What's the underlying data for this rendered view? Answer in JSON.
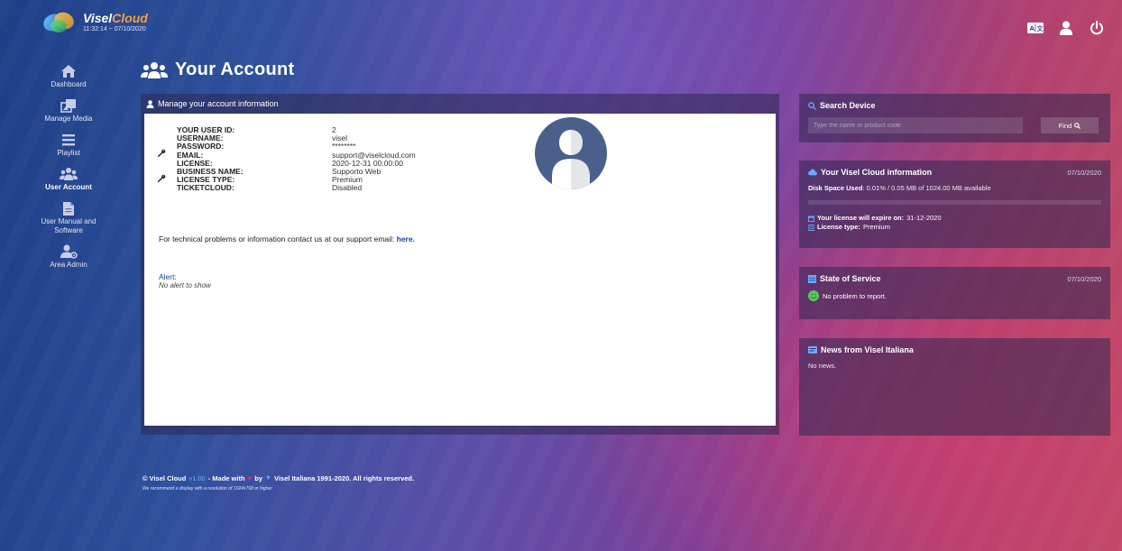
{
  "header": {
    "brand_part1": "Visel",
    "brand_part2": "Cloud",
    "clock": "11:32:14 ~ 07/10/2020",
    "icons": [
      "translate-icon",
      "user-icon",
      "power-icon"
    ]
  },
  "sidebar": {
    "items": [
      {
        "label": "Dashboard",
        "icon": "home-icon"
      },
      {
        "label": "Manage Media",
        "icon": "media-icon"
      },
      {
        "label": "Playlist",
        "icon": "list-icon"
      },
      {
        "label": "User Account",
        "icon": "users-icon",
        "active": true
      },
      {
        "label": "User Manual and Software",
        "icon": "file-icon"
      },
      {
        "label": "Area Admin",
        "icon": "admin-icon"
      }
    ]
  },
  "page": {
    "title": "Your Account"
  },
  "account": {
    "panel_title": "Manage your account information",
    "fields": [
      {
        "key": "YOUR USER ID:",
        "value": "2"
      },
      {
        "key": "USERNAME:",
        "value": "visel"
      },
      {
        "key": "PASSWORD:",
        "value": "********"
      },
      {
        "key": "EMAIL:",
        "value": "support@viselcloud.com"
      },
      {
        "key": "LICENSE:",
        "value": "2020-12-31 00:00:00"
      },
      {
        "key": "BUSINESS NAME:",
        "value": "Supporto Web"
      },
      {
        "key": "LICENSE TYPE:",
        "value": "Premium"
      },
      {
        "key": "TICKETCLOUD:",
        "value": "Disabled"
      }
    ],
    "contact_text": "For technical problems or information contact us at our support email:",
    "contact_link": "here.",
    "alert_label": "Alert:",
    "alert_value": "No alert to show"
  },
  "search": {
    "title": "Search Device",
    "placeholder": "Type the name or product code",
    "button": "Find"
  },
  "cloud_info": {
    "title": "Your Visel Cloud information",
    "date": "07/10/2020",
    "disk_label": "Disk Space Used",
    "disk_text": ": 0.01% / 0.05 MB of 1024.00 MB available",
    "disk_percent": 0.01,
    "license_expire_label": "Your license will expire on:",
    "license_expire_value": "31-12-2020",
    "license_type_label": "License type:",
    "license_type_value": "Premium"
  },
  "service": {
    "title": "State of Service",
    "date": "07/10/2020",
    "status": "No problem to report."
  },
  "news": {
    "title": "News from Visel Italiana",
    "text": "No news."
  },
  "footer": {
    "copyright_prefix": "© Visel Cloud",
    "version": "v1.00",
    "made_with": "- Made with",
    "by": "by",
    "owner": "Visel Italiana 1991-2020. All rights reserved.",
    "recommend": "We recommend a display with a resolution of 1024x768 or higher"
  },
  "colors": {
    "accent": "#6aa9ff",
    "brand_orange": "#f4a23a",
    "link": "#1e3f9c",
    "ok_green": "#5ac85a"
  }
}
